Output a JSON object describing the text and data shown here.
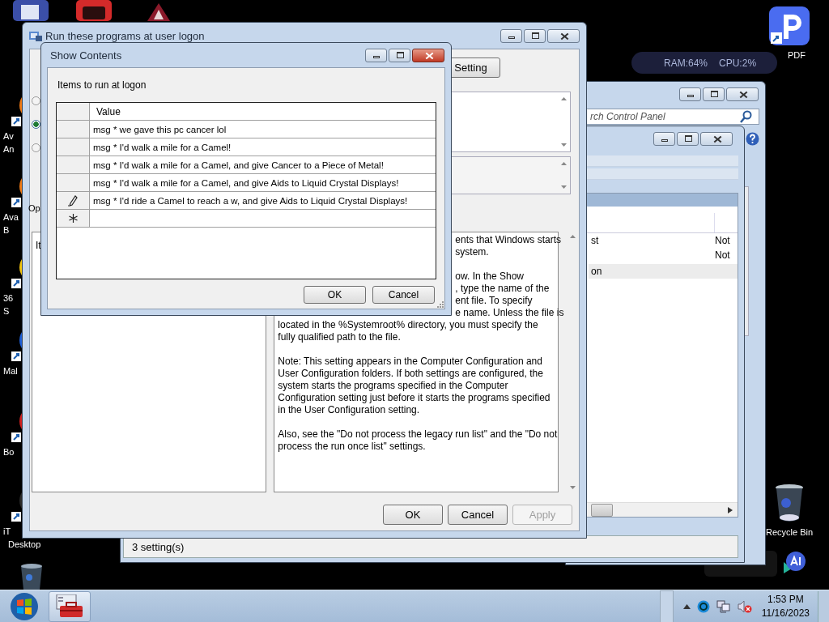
{
  "desktop": {
    "left_icons": [
      {
        "lines": [
          "Av",
          "An"
        ]
      },
      {
        "lines": [
          "Ava",
          "B"
        ]
      },
      {
        "lines": [
          "36",
          "S"
        ]
      },
      {
        "lines": [
          "Mal"
        ]
      },
      {
        "lines": [
          "Bo"
        ]
      },
      {
        "lines": [
          "iT",
          "Desktop"
        ]
      }
    ],
    "pdf_label": "PDF",
    "recycle_label": "Recycle Bin"
  },
  "monitor_widget": {
    "ram": "RAM:64%",
    "cpu": "CPU:2%"
  },
  "control_panel": {
    "search": {
      "placeholder": "rch Control Panel"
    }
  },
  "policy_editor": {
    "rows": [
      {
        "name": "st",
        "state": "Not",
        "selected": false
      },
      {
        "state": "Not",
        "selected": false
      },
      {
        "name": "on",
        "selected": true
      }
    ],
    "status_bar": "3 setting(s)"
  },
  "policy_window": {
    "title": "Run these programs at user logon",
    "setting_button": "Setting",
    "radios": [
      {
        "selected": false
      },
      {
        "selected": true
      },
      {
        "selected": false
      }
    ],
    "options_label": "Op",
    "items_label": "It",
    "help": [
      [
        {
          "text": "ents that Windows starts",
          "kind": "cut"
        },
        {
          "text": "system.",
          "kind": "cut"
        }
      ],
      [
        {
          "text": "ow. In the Show",
          "kind": "cut"
        },
        {
          "text": ", type the name of the",
          "kind": "cut"
        },
        {
          "text": "ent file. To specify",
          "kind": "cut"
        },
        {
          "text": "e name. Unless the file is",
          "kind": "cut"
        },
        {
          "text": "located in the %Systemroot% directory, you must specify the",
          "kind": "full"
        },
        {
          "text": "fully qualified path to the file.",
          "kind": "full"
        }
      ],
      [
        {
          "text": "Note: This setting appears in the Computer Configuration and",
          "kind": "full"
        },
        {
          "text": "User Configuration folders. If both settings are configured, the",
          "kind": "full"
        },
        {
          "text": "system starts the programs specified in the Computer",
          "kind": "full"
        },
        {
          "text": "Configuration setting just before it starts the programs specified",
          "kind": "full"
        },
        {
          "text": "in the User Configuration setting.",
          "kind": "full"
        }
      ],
      [
        {
          "text": "Also, see the \"Do not process the legacy run list\" and the \"Do not",
          "kind": "full"
        },
        {
          "text": "process the run once list\" settings.",
          "kind": "full"
        }
      ]
    ],
    "buttons": [
      {
        "label": "OK",
        "disabled": false
      },
      {
        "label": "Cancel",
        "disabled": false
      },
      {
        "label": "Apply",
        "disabled": true
      }
    ]
  },
  "dialog": {
    "title": "Show Contents",
    "label": "Items to run at logon",
    "column": "Value",
    "rows": [
      {
        "value": "msg * we gave this pc cancer lol",
        "editing": false
      },
      {
        "value": "msg * I'd walk a mile for a Camel!",
        "editing": false
      },
      {
        "value": "msg * I'd walk a mile for a Camel, and give Cancer to a Piece of Metal!",
        "editing": false
      },
      {
        "value": "msg * I'd walk a mile for a Camel, and give Aids to Liquid Crystal Displays!",
        "editing": false
      },
      {
        "value": "msg * I'd ride a Camel to reach a w, and give Aids to Liquid Crystal Displays!",
        "editing": true
      }
    ],
    "buttons": [
      "OK",
      "Cancel"
    ]
  },
  "taskbar": {
    "clock": {
      "time": "1:53 PM",
      "date": "11/16/2023"
    }
  }
}
